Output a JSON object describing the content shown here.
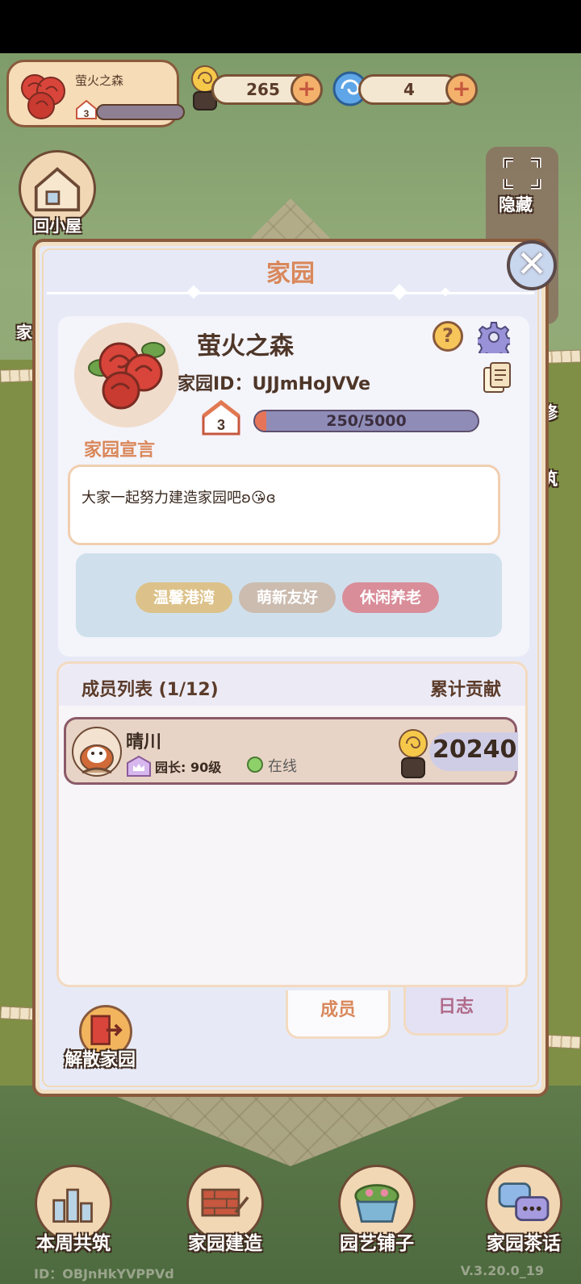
{
  "topbar": {
    "team_name": "萤火之森",
    "level": "3",
    "coins": "265",
    "gems": "4"
  },
  "side": {
    "back_home_label": "回小屋",
    "partial_left_label": "家",
    "hide_label": "隐藏",
    "repair_label": "修",
    "build_label": "筑"
  },
  "modal": {
    "title": "家园",
    "team_name": "萤火之森",
    "team_id_label": "家园ID：",
    "team_id_value": "UJJmHoJVVe",
    "level": "3",
    "progress_text": "250/5000",
    "progress_fraction": 0.05,
    "declaration_label": "家园宣言",
    "declaration_text": "大家一起努力建造家园吧ʚ😘ɞ",
    "tags": [
      {
        "label": "温馨港湾",
        "color": "#dcc28a"
      },
      {
        "label": "萌新友好",
        "color": "#ccbcb0"
      },
      {
        "label": "休闲养老",
        "color": "#d98d99"
      }
    ],
    "members_title": "成员列表 (1/12)",
    "contribution_title": "累计贡献",
    "members": [
      {
        "name": "晴川",
        "role": "园长: 90级",
        "status": "在线",
        "contribution": "20240"
      }
    ],
    "tabs": {
      "members": "成员",
      "log": "日志"
    },
    "disband_label": "解散家园"
  },
  "bottom_nav": [
    {
      "label": "本周共筑",
      "icon": "weekly-build-icon"
    },
    {
      "label": "家园建造",
      "icon": "bricks-trowel-icon"
    },
    {
      "label": "园艺铺子",
      "icon": "flower-pot-icon"
    },
    {
      "label": "家园茶话",
      "icon": "chat-bubbles-icon"
    }
  ],
  "footer": {
    "id": "ID：OBJnHkYVPPVd",
    "version": "V.3.20.0_19"
  }
}
